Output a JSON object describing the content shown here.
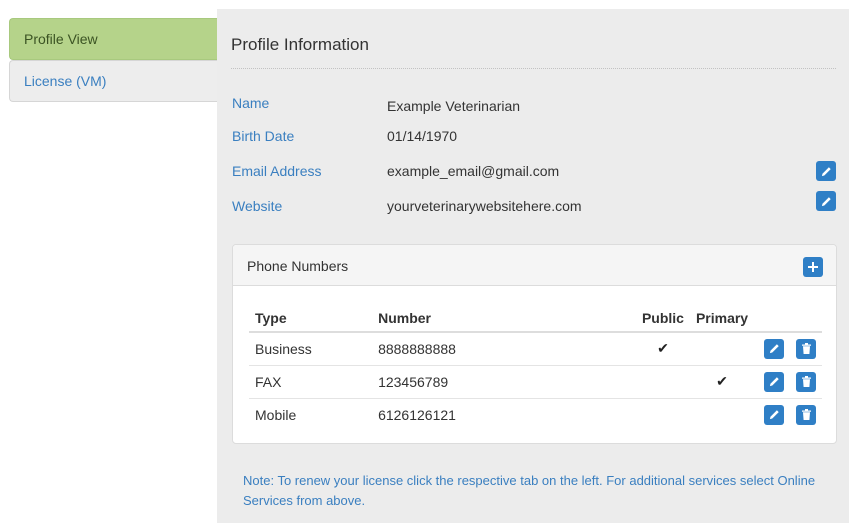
{
  "sidebar": {
    "items": [
      {
        "label": "Profile View",
        "active": true
      },
      {
        "label": "License (VM)",
        "active": false
      }
    ]
  },
  "profile": {
    "title": "Profile Information",
    "fields": [
      {
        "label": "Name",
        "value": "Example Veterinarian"
      },
      {
        "label": "Birth Date",
        "value": "01/14/1970"
      },
      {
        "label": "Email Address",
        "value": "example_email@gmail.com"
      },
      {
        "label": "Website",
        "value": "yourveterinarywebsitehere.com"
      }
    ]
  },
  "phones": {
    "title": "Phone Numbers",
    "headers": {
      "type": "Type",
      "number": "Number",
      "public": "Public",
      "primary": "Primary"
    },
    "rows": [
      {
        "type": "Business",
        "number": "8888888888",
        "public": "✔",
        "primary": ""
      },
      {
        "type": "FAX",
        "number": "123456789",
        "public": "",
        "primary": "✔"
      },
      {
        "type": "Mobile",
        "number": "6126126121",
        "public": "",
        "primary": ""
      }
    ]
  },
  "note": "Note: To renew your license click the respective tab on the left. For additional services select Online Services from above.",
  "colors": {
    "accent": "#2f7fc6",
    "active_tab": "#b5d38a",
    "link": "#3a7fc0"
  },
  "icons": [
    "pencil-icon",
    "plus-icon",
    "trash-icon",
    "check-icon"
  ]
}
